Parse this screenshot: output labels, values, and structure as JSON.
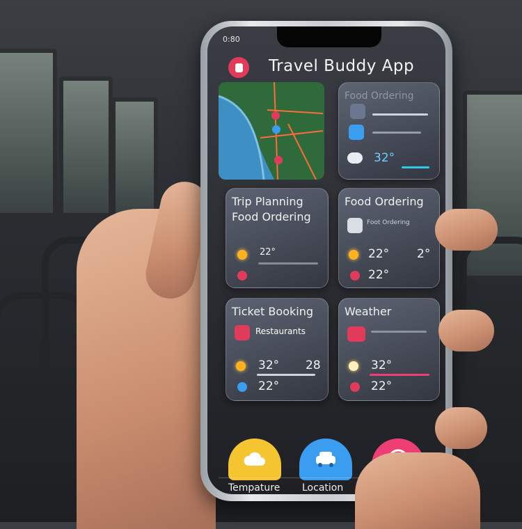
{
  "status_bar": {
    "time": "0:80"
  },
  "header": {
    "app_title": "Travel Buddy App"
  },
  "cards": [
    {
      "title": "Food Ordering",
      "sub": "",
      "temp": "32°",
      "temp2": ""
    },
    {
      "title": "Trip Planning\nFood Ordering",
      "sub": "",
      "temp": "22°",
      "temp2": ""
    },
    {
      "title": "Food Ordering",
      "sub": "Foot Ordering",
      "temp": "22°",
      "temp2": "2°",
      "temp3": "22°"
    },
    {
      "title": "Ticket Booking",
      "sub": "Restaurants",
      "temp": "32°",
      "temp2": "28",
      "temp3": "22°"
    },
    {
      "title": "Weather",
      "sub": "",
      "temp": "32°",
      "temp3": "22°"
    }
  ],
  "dock": [
    {
      "label": "Tempature",
      "icon": "cloud-icon",
      "color": "#f5c431"
    },
    {
      "label": "Location",
      "icon": "car-icon",
      "color": "#3b9df0"
    },
    {
      "label": "",
      "icon": "heart-icon",
      "color": "#ee3f75"
    }
  ],
  "colors": {
    "accent_red": "#e23a5a",
    "sun": "#ffb21e",
    "cyan": "#2ec9e6"
  }
}
